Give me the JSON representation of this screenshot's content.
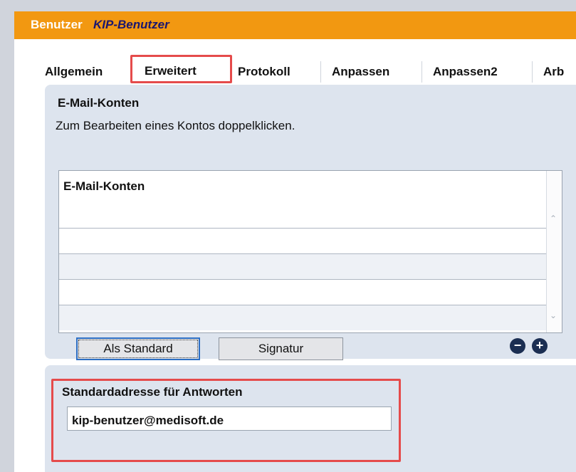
{
  "window": {
    "title": "Benutzer",
    "user": "KIP-Benutzer"
  },
  "tabs": [
    {
      "label": "Allgemein"
    },
    {
      "label": "Erweitert"
    },
    {
      "label": "Protokoll"
    },
    {
      "label": "Anpassen"
    },
    {
      "label": "Anpassen2"
    },
    {
      "label": "Arb"
    }
  ],
  "email_accounts": {
    "title": "E-Mail-Konten",
    "hint": "Zum Bearbeiten eines Kontos doppelklicken.",
    "column_header": "E-Mail-Konten",
    "rows": [],
    "default_button": "Als Standard",
    "signature_button": "Signatur",
    "remove_icon": "minus-circle-icon",
    "add_icon": "plus-circle-icon"
  },
  "reply": {
    "label": "Standardadresse für Antworten",
    "value": "kip-benutzer@medisoft.de"
  },
  "colors": {
    "titlebar": "#f29811",
    "user_name": "#1a1670",
    "highlight": "#e54b4b",
    "panel": "#dde4ee"
  }
}
